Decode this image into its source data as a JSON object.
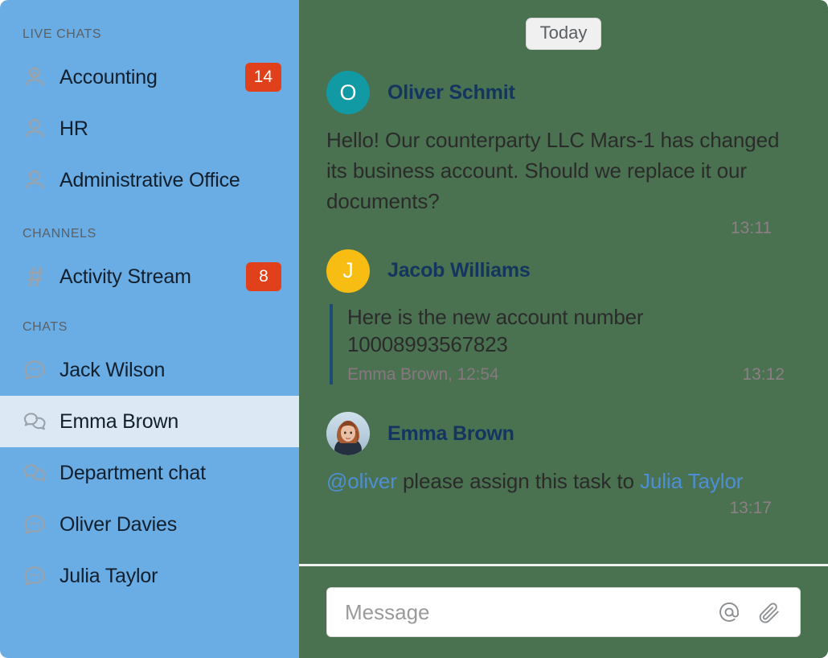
{
  "theme": {
    "sidebar_bg": "#6aace4",
    "sidebar_selected_bg": "#dce9f4",
    "chat_bg": "#4a7150",
    "badge_bg": "#e0401a",
    "author_color": "#13355f",
    "link_color": "#4e8fd4",
    "quote_bar_color": "#1c4d72"
  },
  "sidebar": {
    "sections": [
      {
        "title": "LIVE CHATS",
        "items": [
          {
            "label": "Accounting",
            "icon": "support-agent-icon",
            "badge": "14",
            "selected": false
          },
          {
            "label": "HR",
            "icon": "support-agent-icon",
            "badge": "",
            "selected": false
          },
          {
            "label": "Administrative Office",
            "icon": "support-agent-icon",
            "badge": "",
            "selected": false
          }
        ]
      },
      {
        "title": "CHANNELS",
        "items": [
          {
            "label": "Activity Stream",
            "icon": "hash-icon",
            "badge": "8",
            "selected": false
          }
        ]
      },
      {
        "title": "CHATS",
        "items": [
          {
            "label": "Jack Wilson",
            "icon": "chat-bubble-dots-icon",
            "badge": "",
            "selected": false
          },
          {
            "label": "Emma Brown",
            "icon": "chat-bubbles-group-icon",
            "badge": "",
            "selected": true
          },
          {
            "label": "Department chat",
            "icon": "chat-bubbles-group-icon",
            "badge": "",
            "selected": false
          },
          {
            "label": "Oliver Davies",
            "icon": "chat-bubble-dots-icon",
            "badge": "",
            "selected": false
          },
          {
            "label": "Julia Taylor",
            "icon": "chat-bubble-dots-icon",
            "badge": "",
            "selected": false
          }
        ]
      }
    ]
  },
  "chat": {
    "day_divider": "Today",
    "messages": [
      {
        "author": "Oliver Schmit",
        "avatar_type": "initial",
        "avatar_initial": "O",
        "avatar_color": "teal",
        "text": "Hello! Our counterparty LLC Mars-1 has changed its business account. Should we replace it our documents?",
        "time": "13:11"
      },
      {
        "author": "Jacob Williams",
        "avatar_type": "initial",
        "avatar_initial": "J",
        "avatar_color": "yellow",
        "quote_text": "Here is the new account number 10008993567823",
        "quote_meta": "Emma Brown, 12:54",
        "time": "13:12"
      },
      {
        "author": "Emma Brown",
        "avatar_type": "photo",
        "avatar_initial": "",
        "avatar_color": "photo",
        "mention": "@oliver",
        "text_middle": " please assign this task to ",
        "link_name": "Julia Taylor",
        "time": "13:17"
      }
    ]
  },
  "composer": {
    "placeholder": "Message",
    "value": "",
    "mention_icon": "at-sign-icon",
    "attach_icon": "paperclip-icon"
  }
}
